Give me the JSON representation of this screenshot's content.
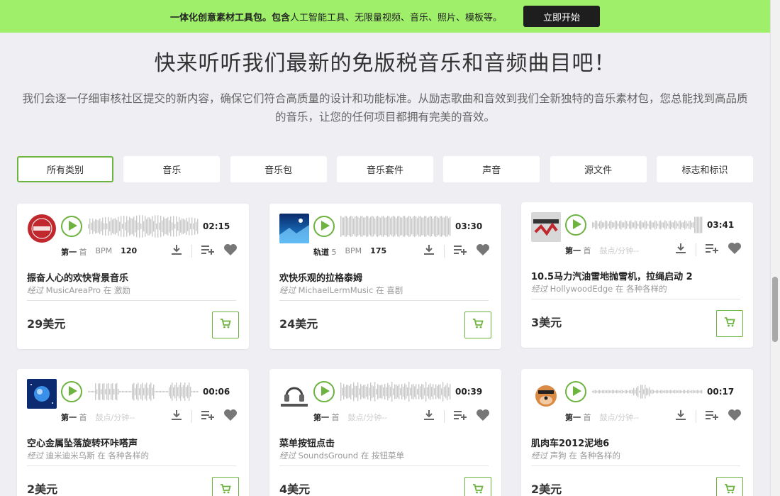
{
  "promo": {
    "text_bold": "一体化创意素材工具包。包含",
    "text_rest": "人工智能工具、无限量视频、音乐、照片、模板等。",
    "button": "立即开始"
  },
  "heading": "快来听听我们最新的免版税音乐和音频曲目吧！",
  "intro": "我们会逐一仔细审核社区提交的新内容，确保它们符合高质量的设计和功能标准。从励志歌曲和音效到我们全新独特的音乐素材包，您总能找到高品质的音乐，让您的任何项目都拥有完美的音效。",
  "filters": [
    {
      "label": "所有类别",
      "active": true
    },
    {
      "label": "音乐",
      "active": false
    },
    {
      "label": "音乐包",
      "active": false
    },
    {
      "label": "音乐套件",
      "active": false
    },
    {
      "label": "声音",
      "active": false
    },
    {
      "label": "源文件",
      "active": false
    },
    {
      "label": "标志和标识",
      "active": false
    }
  ],
  "colors": {
    "accent": "#6db33f",
    "promo_bg": "#9fef6b"
  },
  "cards": [
    {
      "title": "振奋人心的欢快背景音乐",
      "by_word": "经过",
      "author": "MusicAreaPro",
      "in_word": "在",
      "category": "激励",
      "price": "29美元",
      "duration": "02:15",
      "meta1": "第一",
      "meta1_unit": "首",
      "meta2_label": "BPM",
      "meta2_value": "120",
      "thumb_icon": "red-circle-logo-icon"
    },
    {
      "title": "欢快乐观的拉格泰姆",
      "by_word": "经过",
      "author": "MichaelLermMusic",
      "in_word": "在",
      "category": "喜剧",
      "price": "24美元",
      "duration": "03:30",
      "meta1": "轨道",
      "meta1_unit": "5",
      "meta2_label": "BPM",
      "meta2_value": "175",
      "thumb_icon": "blue-abstract-art-icon"
    },
    {
      "title": "10.5马力汽油雪地抛雪机，拉绳启动 2",
      "by_word": "经过",
      "author": "HollywoodEdge",
      "in_word": "在",
      "category": "各种各样的",
      "price": "3美元",
      "duration": "03:41",
      "meta1": "第一",
      "meta1_unit": "首",
      "meta2_label": "鼓点/分钟--",
      "meta2_value": "",
      "thumb_icon": "hollywood-edge-logo-icon"
    },
    {
      "title": "空心金属坠落旋转环咔嗒声",
      "by_word": "经过",
      "author": "迪米迪米乌斯",
      "in_word": "在",
      "category": "各种各样的",
      "price": "2美元",
      "duration": "00:06",
      "meta1": "第一",
      "meta1_unit": "首",
      "meta2_label": "鼓点/分钟--",
      "meta2_value": "",
      "thumb_icon": "blue-planet-icon"
    },
    {
      "title": "菜单按钮点击",
      "by_word": "经过",
      "author": "SoundsGround",
      "in_word": "在",
      "category": "按钮菜单",
      "price": "4美元",
      "duration": "00:39",
      "meta1": "第一",
      "meta1_unit": "首",
      "meta2_label": "鼓点/分钟--",
      "meta2_value": "",
      "thumb_icon": "headphones-logo-icon",
      "thumb_caption": "SoundsGround"
    },
    {
      "title": "肌肉车2012泥地6",
      "by_word": "经过",
      "author": "声狗",
      "in_word": "在",
      "category": "各种各样的",
      "price": "2美元",
      "duration": "00:17",
      "meta1": "第一",
      "meta1_unit": "首",
      "meta2_label": "鼓点/分钟--",
      "meta2_value": "",
      "thumb_icon": "cartoon-dog-icon"
    }
  ]
}
